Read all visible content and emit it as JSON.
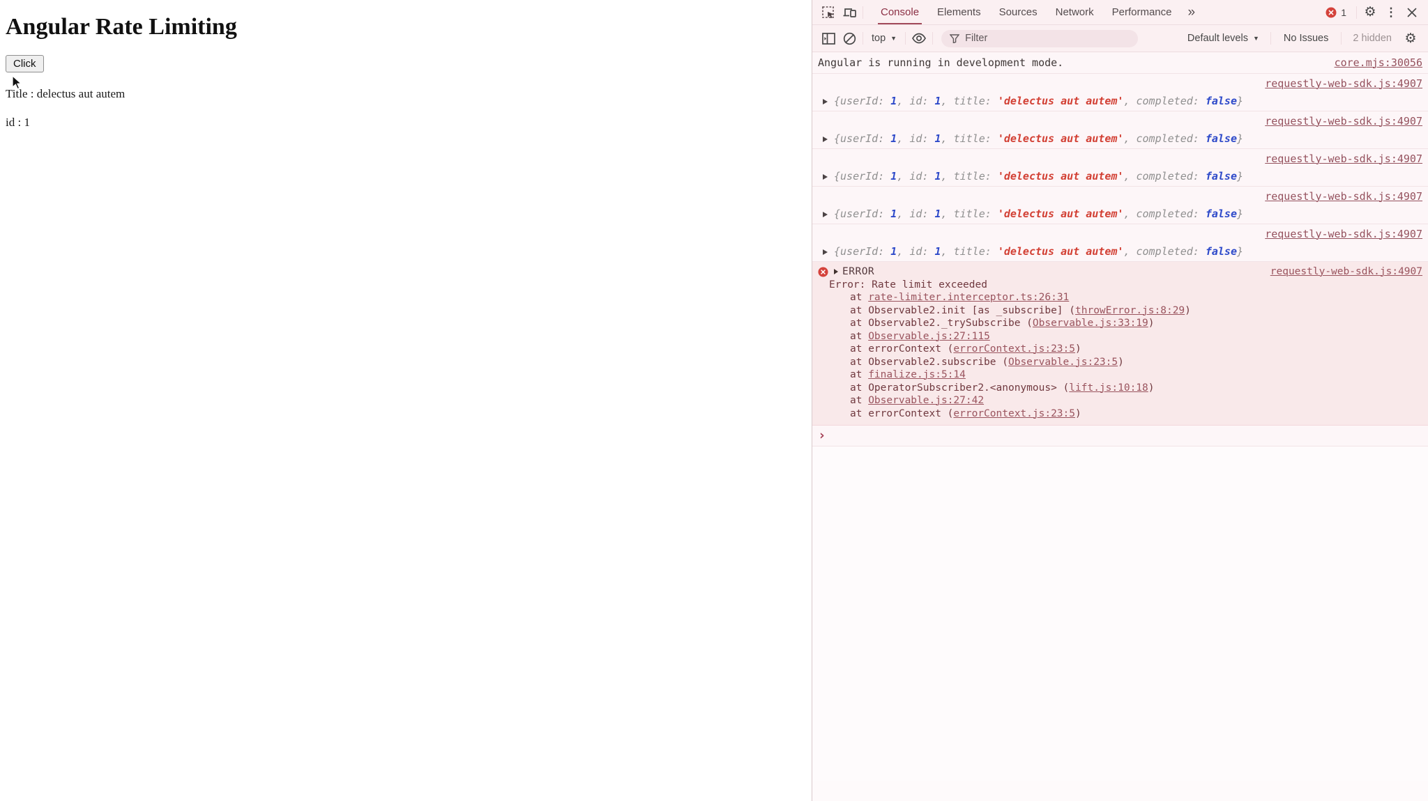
{
  "page": {
    "title": "Angular Rate Limiting",
    "button_label": "Click",
    "title_line": "Title : delectus aut autem",
    "id_line": "id : 1"
  },
  "devtools": {
    "tabs": [
      "Console",
      "Elements",
      "Sources",
      "Network",
      "Performance"
    ],
    "active_tab": "Console",
    "error_badge_count": "1",
    "icons": {
      "more_tabs_glyph": "»",
      "gear_glyph": "⚙",
      "kebab_glyph": "⋮",
      "caret_glyph": "▼"
    },
    "toolbar": {
      "context_selector": "top",
      "filter_placeholder": "Filter",
      "levels_label": "Default levels",
      "issues_label": "No Issues",
      "hidden_label": "2 hidden"
    },
    "console": {
      "first_message": {
        "text": "Angular is running in development mode.",
        "source": "core.mjs:30056"
      },
      "log_preview": [
        {
          "text": "{",
          "type": "punct"
        },
        {
          "text": "userId",
          "type": "key"
        },
        {
          "text": ": ",
          "type": "punct"
        },
        {
          "text": "1",
          "type": "num"
        },
        {
          "text": ", ",
          "type": "punct"
        },
        {
          "text": "id",
          "type": "key"
        },
        {
          "text": ": ",
          "type": "punct"
        },
        {
          "text": "1",
          "type": "num"
        },
        {
          "text": ", ",
          "type": "punct"
        },
        {
          "text": "title",
          "type": "key"
        },
        {
          "text": ": ",
          "type": "punct"
        },
        {
          "text": "'delectus aut autem'",
          "type": "str"
        },
        {
          "text": ", ",
          "type": "punct"
        },
        {
          "text": "completed",
          "type": "key"
        },
        {
          "text": ": ",
          "type": "punct"
        },
        {
          "text": "false",
          "type": "bool"
        },
        {
          "text": "}",
          "type": "punct"
        }
      ],
      "logs": [
        {
          "source": "requestly-web-sdk.js:4907"
        },
        {
          "source": "requestly-web-sdk.js:4907"
        },
        {
          "source": "requestly-web-sdk.js:4907"
        },
        {
          "source": "requestly-web-sdk.js:4907"
        },
        {
          "source": "requestly-web-sdk.js:4907"
        }
      ],
      "error": {
        "label": "ERROR",
        "source": "requestly-web-sdk.js:4907",
        "message": "Error: Rate limit exceeded",
        "stack": [
          {
            "pre": "at ",
            "link": "rate-limiter.interceptor.ts:26:31",
            "post": ""
          },
          {
            "pre": "at Observable2.init [as _subscribe] (",
            "link": "throwError.js:8:29",
            "post": ")"
          },
          {
            "pre": "at Observable2._trySubscribe (",
            "link": "Observable.js:33:19",
            "post": ")"
          },
          {
            "pre": "at ",
            "link": "Observable.js:27:115",
            "post": ""
          },
          {
            "pre": "at errorContext (",
            "link": "errorContext.js:23:5",
            "post": ")"
          },
          {
            "pre": "at Observable2.subscribe (",
            "link": "Observable.js:23:5",
            "post": ")"
          },
          {
            "pre": "at ",
            "link": "finalize.js:5:14",
            "post": ""
          },
          {
            "pre": "at OperatorSubscriber2.<anonymous> (",
            "link": "lift.js:10:18",
            "post": ")"
          },
          {
            "pre": "at ",
            "link": "Observable.js:27:42",
            "post": ""
          },
          {
            "pre": "at errorContext (",
            "link": "errorContext.js:23:5",
            "post": ")"
          }
        ]
      },
      "prompt_glyph": "›"
    },
    "colors": {
      "accent_maroon": "#8b2f44",
      "toolbar_bg": "#fbf0f2",
      "console_bg": "#fdf6f8",
      "error_bg": "#f9e9ea",
      "error_text": "#70393f",
      "link": "#95525e",
      "badge_red": "#d4423b",
      "num_blue": "#2d49c9",
      "string_red": "#d23f33"
    }
  }
}
